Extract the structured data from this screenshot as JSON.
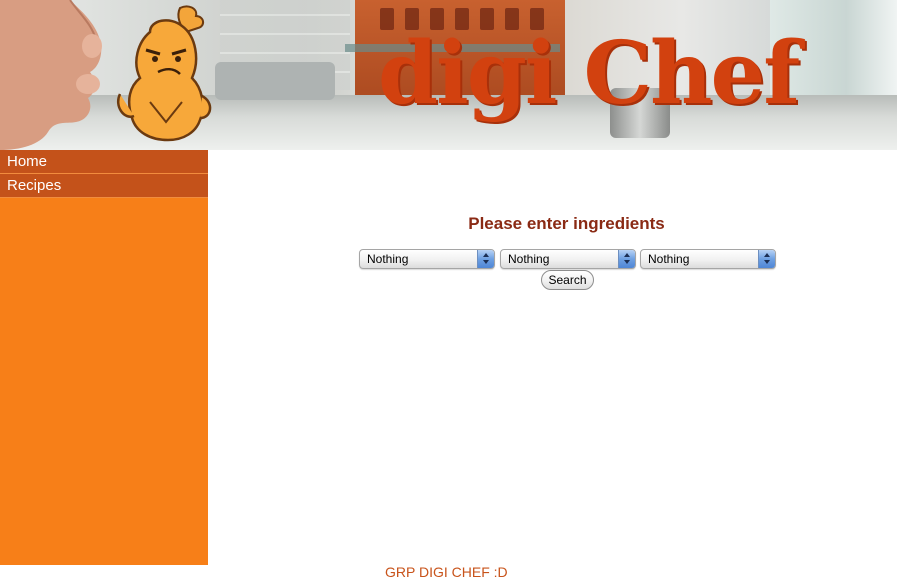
{
  "banner": {
    "logo_text": "digi Chef"
  },
  "sidebar": {
    "items": [
      {
        "label": "Home"
      },
      {
        "label": "Recipes"
      }
    ]
  },
  "main": {
    "title": "Please enter ingredients",
    "ingredient_selects": [
      {
        "value": "Nothing"
      },
      {
        "value": "Nothing"
      },
      {
        "value": "Nothing"
      }
    ],
    "search_label": "Search"
  },
  "footer": {
    "text": "GRP DIGI CHEF :D"
  },
  "colors": {
    "sidebar": "#f77f18",
    "nav_item": "#c4521a",
    "logo": "#d2410f",
    "title": "#8a2a14",
    "footer": "#c8531a"
  }
}
